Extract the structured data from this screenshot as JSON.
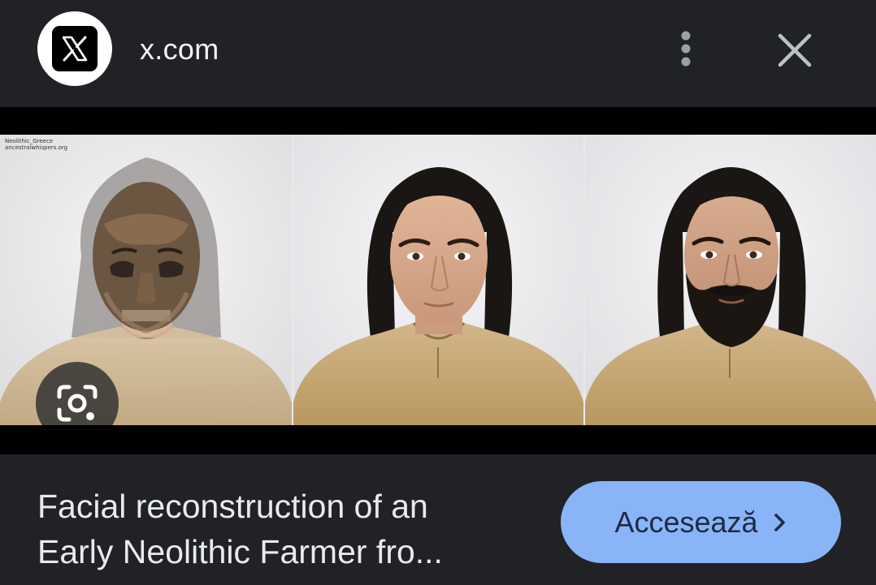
{
  "header": {
    "site_name": "x.com",
    "logo_icon": "x-logo-icon",
    "menu_icon": "more-vert-icon",
    "close_icon": "close-icon"
  },
  "image": {
    "watermark_line1": "Neolithic_Greece",
    "watermark_line2": "ancestralwhispers.org",
    "lens_icon": "google-lens-icon"
  },
  "caption": {
    "line1": "Facial reconstruction of an",
    "line2": "Early Neolithic Farmer fro..."
  },
  "visit_button": {
    "label": "Accesează",
    "icon": "chevron-right-icon",
    "color": "#8ab4f8"
  },
  "colors": {
    "background": "#212226",
    "text": "#e8eaed"
  }
}
